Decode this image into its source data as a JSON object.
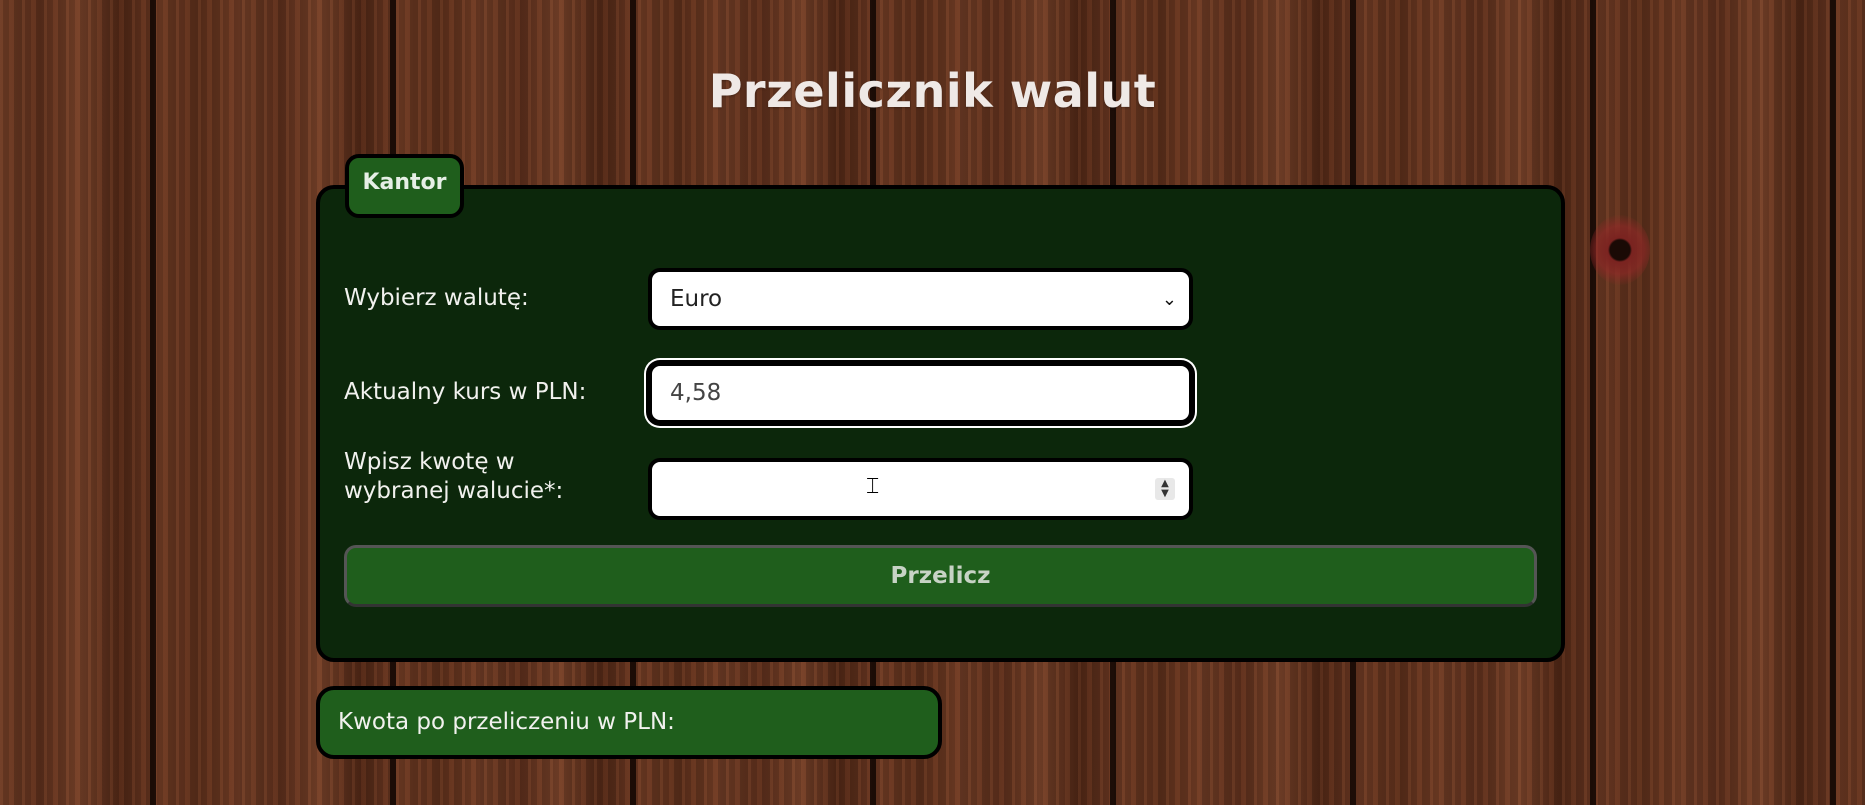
{
  "page": {
    "title": "Przelicznik walut"
  },
  "kantor": {
    "tab_label": "Kantor",
    "currency": {
      "label": "Wybierz walutę:",
      "selected": "Euro"
    },
    "rate": {
      "label": "Aktualny kurs w PLN:",
      "value": "4,58"
    },
    "amount": {
      "label_line1": "Wpisz kwotę w",
      "label_line2": "wybranej walucie*:",
      "value": ""
    },
    "submit_label": "Przelicz"
  },
  "result": {
    "label": "Kwota po przeliczeniu w PLN:"
  },
  "colors": {
    "panel_bg": "#0c270b",
    "accent_green": "#1f5e1c",
    "title_text": "#efe9e6"
  }
}
